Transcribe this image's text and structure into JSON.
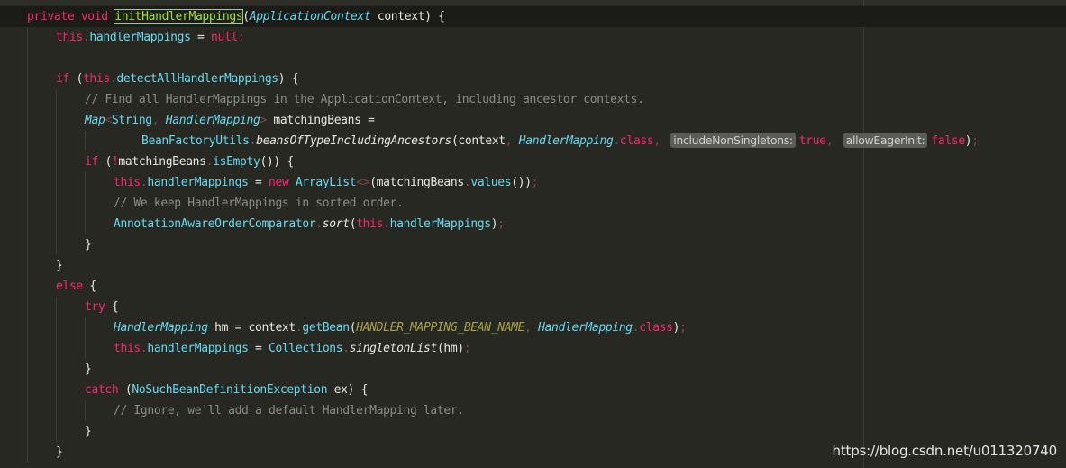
{
  "editor": {
    "lines": [
      {
        "tokens": [
          {
            "t": "private",
            "c": "t-kw"
          },
          {
            "t": " ",
            "c": "t-plain"
          },
          {
            "t": "void",
            "c": "t-kw"
          },
          {
            "t": " ",
            "c": "t-plain"
          },
          {
            "t": "initHandlerMappings",
            "c": "hl-box"
          },
          {
            "t": "(",
            "c": "t-punct"
          },
          {
            "t": "ApplicationContext",
            "c": "t-type-i"
          },
          {
            "t": " context) {",
            "c": "t-plain"
          }
        ]
      },
      {
        "tokens": [
          {
            "t": "this",
            "c": "t-kw"
          },
          {
            "t": ".",
            "c": "t-dim"
          },
          {
            "t": "handlerMappings",
            "c": "t-field"
          },
          {
            "t": " = ",
            "c": "t-plain"
          },
          {
            "t": "null",
            "c": "t-kw"
          },
          {
            "t": ";",
            "c": "t-dim"
          }
        ]
      },
      {
        "tokens": []
      },
      {
        "tokens": [
          {
            "t": "if",
            "c": "t-kw"
          },
          {
            "t": " (",
            "c": "t-plain"
          },
          {
            "t": "this",
            "c": "t-kw"
          },
          {
            "t": ".",
            "c": "t-dim"
          },
          {
            "t": "detectAllHandlerMappings",
            "c": "t-field"
          },
          {
            "t": ") {",
            "c": "t-plain"
          }
        ]
      },
      {
        "tokens": [
          {
            "t": "// Find all HandlerMappings in the ApplicationContext, including ancestor contexts.",
            "c": "t-comment"
          }
        ]
      },
      {
        "tokens": [
          {
            "t": "Map",
            "c": "t-type-i"
          },
          {
            "t": "<",
            "c": "t-dim"
          },
          {
            "t": "String",
            "c": "t-type"
          },
          {
            "t": ", ",
            "c": "t-dim"
          },
          {
            "t": "HandlerMapping",
            "c": "t-type-i"
          },
          {
            "t": ">",
            "c": "t-dim"
          },
          {
            "t": " matchingBeans = ",
            "c": "t-plain"
          }
        ]
      },
      {
        "tokens": [
          {
            "t": "BeanFactoryUtils",
            "c": "t-type"
          },
          {
            "t": ".",
            "c": "t-dim"
          },
          {
            "t": "beansOfTypeIncludingAncestors",
            "c": "t-static-i"
          },
          {
            "t": "(context",
            "c": "t-plain"
          },
          {
            "t": ", ",
            "c": "t-dim"
          },
          {
            "t": "HandlerMapping",
            "c": "t-type-i"
          },
          {
            "t": ".",
            "c": "t-dim"
          },
          {
            "t": "class",
            "c": "t-kw"
          },
          {
            "t": ", ",
            "c": "t-dim"
          },
          {
            "t": "includeNonSingletons:",
            "c": "hint"
          },
          {
            "t": "true",
            "c": "t-kw"
          },
          {
            "t": ", ",
            "c": "t-dim"
          },
          {
            "t": "allowEagerInit:",
            "c": "hint"
          },
          {
            "t": "false",
            "c": "t-kw"
          },
          {
            "t": ")",
            "c": "t-plain"
          },
          {
            "t": ";",
            "c": "t-dim"
          }
        ]
      },
      {
        "tokens": [
          {
            "t": "if",
            "c": "t-kw"
          },
          {
            "t": " (",
            "c": "t-plain"
          },
          {
            "t": "!",
            "c": "t-kw"
          },
          {
            "t": "matchingBeans",
            "c": "t-plain"
          },
          {
            "t": ".",
            "c": "t-dim"
          },
          {
            "t": "isEmpty",
            "c": "t-method"
          },
          {
            "t": "()) {",
            "c": "t-plain"
          }
        ]
      },
      {
        "tokens": [
          {
            "t": "this",
            "c": "t-kw"
          },
          {
            "t": ".",
            "c": "t-dim"
          },
          {
            "t": "handlerMappings",
            "c": "t-field"
          },
          {
            "t": " = ",
            "c": "t-plain"
          },
          {
            "t": "new",
            "c": "t-kw"
          },
          {
            "t": " ",
            "c": "t-plain"
          },
          {
            "t": "ArrayList",
            "c": "t-type"
          },
          {
            "t": "<>",
            "c": "t-dim"
          },
          {
            "t": "(matchingBeans",
            "c": "t-plain"
          },
          {
            "t": ".",
            "c": "t-dim"
          },
          {
            "t": "values",
            "c": "t-method"
          },
          {
            "t": "())",
            "c": "t-plain"
          },
          {
            "t": ";",
            "c": "t-dim"
          }
        ]
      },
      {
        "tokens": [
          {
            "t": "// We keep HandlerMappings in sorted order.",
            "c": "t-comment"
          }
        ]
      },
      {
        "tokens": [
          {
            "t": "AnnotationAwareOrderComparator",
            "c": "t-type"
          },
          {
            "t": ".",
            "c": "t-dim"
          },
          {
            "t": "sort",
            "c": "t-static-i"
          },
          {
            "t": "(",
            "c": "t-plain"
          },
          {
            "t": "this",
            "c": "t-kw"
          },
          {
            "t": ".",
            "c": "t-dim"
          },
          {
            "t": "handlerMappings",
            "c": "t-field"
          },
          {
            "t": ")",
            "c": "t-plain"
          },
          {
            "t": ";",
            "c": "t-dim"
          }
        ]
      },
      {
        "tokens": [
          {
            "t": "}",
            "c": "t-plain"
          }
        ]
      },
      {
        "tokens": [
          {
            "t": "}",
            "c": "t-plain"
          }
        ]
      },
      {
        "tokens": [
          {
            "t": "else",
            "c": "t-kw"
          },
          {
            "t": " {",
            "c": "t-plain"
          }
        ]
      },
      {
        "tokens": [
          {
            "t": "try",
            "c": "t-kw"
          },
          {
            "t": " {",
            "c": "t-plain"
          }
        ]
      },
      {
        "tokens": [
          {
            "t": "HandlerMapping",
            "c": "t-type-i"
          },
          {
            "t": " hm = context",
            "c": "t-plain"
          },
          {
            "t": ".",
            "c": "t-dim"
          },
          {
            "t": "getBean",
            "c": "t-method"
          },
          {
            "t": "(",
            "c": "t-plain"
          },
          {
            "t": "HANDLER_MAPPING_BEAN_NAME",
            "c": "t-const"
          },
          {
            "t": ", ",
            "c": "t-dim"
          },
          {
            "t": "HandlerMapping",
            "c": "t-type-i"
          },
          {
            "t": ".",
            "c": "t-dim"
          },
          {
            "t": "class",
            "c": "t-kw"
          },
          {
            "t": ")",
            "c": "t-plain"
          },
          {
            "t": ";",
            "c": "t-dim"
          }
        ]
      },
      {
        "tokens": [
          {
            "t": "this",
            "c": "t-kw"
          },
          {
            "t": ".",
            "c": "t-dim"
          },
          {
            "t": "handlerMappings",
            "c": "t-field"
          },
          {
            "t": " = ",
            "c": "t-plain"
          },
          {
            "t": "Collections",
            "c": "t-type"
          },
          {
            "t": ".",
            "c": "t-dim"
          },
          {
            "t": "singletonList",
            "c": "t-static-i"
          },
          {
            "t": "(hm)",
            "c": "t-plain"
          },
          {
            "t": ";",
            "c": "t-dim"
          }
        ]
      },
      {
        "tokens": [
          {
            "t": "}",
            "c": "t-plain"
          }
        ]
      },
      {
        "tokens": [
          {
            "t": "catch",
            "c": "t-kw"
          },
          {
            "t": " (",
            "c": "t-plain"
          },
          {
            "t": "NoSuchBeanDefinitionException",
            "c": "t-type"
          },
          {
            "t": " ex) {",
            "c": "t-plain"
          }
        ]
      },
      {
        "tokens": [
          {
            "t": "// Ignore, we'll add a default HandlerMapping later.",
            "c": "t-comment"
          }
        ]
      },
      {
        "tokens": [
          {
            "t": "}",
            "c": "t-plain"
          }
        ]
      },
      {
        "tokens": [
          {
            "t": "}",
            "c": "t-plain"
          }
        ]
      }
    ]
  },
  "watermark": "https://blog.csdn.net/u011320740",
  "colors": {
    "background": "#272822",
    "keyword": "#f92672",
    "type": "#66d9ef",
    "comment": "#8c8c86",
    "constant": "#a6a046"
  }
}
